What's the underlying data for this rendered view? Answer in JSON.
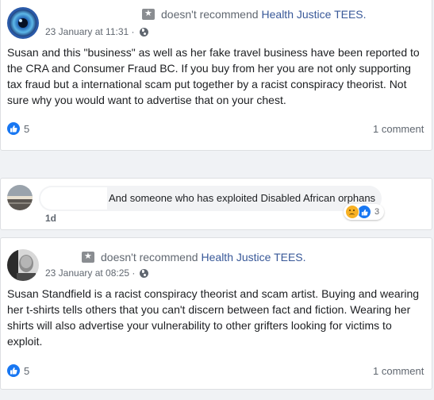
{
  "reviews": [
    {
      "recommend_text": "doesn't recommend",
      "page_name": "Health Justice TEES.",
      "date": "23 January at 11:31 ·",
      "text": "Susan and this \"business\" as well as her fake travel business have been reported to the CRA and Consumer Fraud BC. If you buy from her you are not only supporting tax fraud but a international scam put together by a racist conspiracy theorist. Not sure why you would want to advertise that on your chest.",
      "likes": "5",
      "comments": "1 comment"
    },
    {
      "recommend_text": "doesn't recommend",
      "page_name": "Health Justice TEES.",
      "date": "23 January at 08:25 ·",
      "text": "Susan Standfield is a racist conspiracy theorist and scam artist. Buying and wearing her t-shirts tells others that you can't discern between fact and fiction. Wearing her shirts will also advertise your vulnerability to other grifters looking for victims to exploit.",
      "likes": "5",
      "comments": "1 comment"
    }
  ],
  "reply": {
    "text": "And someone who has exploited Disabled African orphans",
    "time": "1d",
    "reaction_count": "3"
  },
  "icons": {
    "recommend": "recommend-star-icon",
    "privacy": "globe-icon",
    "like": "thumbs-up-icon",
    "sad": "sad-reaction-icon"
  },
  "colors": {
    "link": "#385898",
    "like_blue": "#1877f2",
    "meta_gray": "#606770"
  }
}
